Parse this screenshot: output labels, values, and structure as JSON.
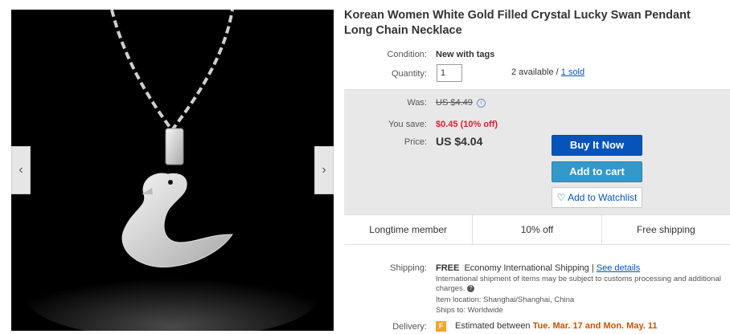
{
  "listing": {
    "title": "Korean Women White Gold Filled Crystal Lucky Swan Pendant Long Chain Necklace",
    "condition_label": "Condition:",
    "condition_value": "New with tags",
    "quantity_label": "Quantity:",
    "quantity_value": "1",
    "available_text": "2 available / ",
    "sold_link": "1 sold"
  },
  "pricing": {
    "was_label": "Was:",
    "was_value": "US $4.49",
    "save_label": "You save:",
    "save_value": "$0.45 (10% off)",
    "price_label": "Price:",
    "price_value": "US $4.04"
  },
  "actions": {
    "buy_now": "Buy It Now",
    "add_to_cart": "Add to cart",
    "watchlist": "Add to Watchlist"
  },
  "badges": [
    "Longtime member",
    "10% off",
    "Free shipping"
  ],
  "shipping": {
    "label": "Shipping:",
    "free": "FREE",
    "method": "Economy International Shipping",
    "separator": "|",
    "see_details": "See details",
    "note": "International shipment of items may be subject to customs processing and additional charges.",
    "location": "Item location:  Shanghai/Shanghai, China",
    "ships_to": "Ships to:  Worldwide"
  },
  "delivery": {
    "label": "Delivery:",
    "estimated": "Estimated between",
    "dates": "Tue. Mar. 17 and Mon. May. 11"
  },
  "icons": {
    "prev": "chevron-left-icon",
    "next": "chevron-right-icon",
    "heart": "heart-icon",
    "info": "info-icon",
    "help": "question-icon",
    "delivery": "delivery-flag-icon"
  },
  "colors": {
    "buy_now": "#0654ba",
    "add_to_cart": "#3498ca",
    "save_red": "#dd1e31",
    "link": "#0654ba"
  }
}
